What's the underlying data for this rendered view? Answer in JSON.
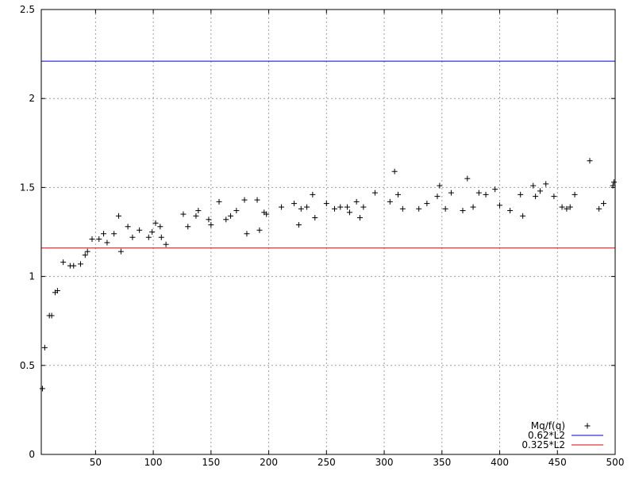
{
  "chart_data": {
    "type": "scatter",
    "title": "",
    "xlabel": "",
    "ylabel": "",
    "xlim": [
      3,
      500
    ],
    "ylim": [
      0,
      2.5
    ],
    "x_ticks": [
      "50",
      "100",
      "150",
      "200",
      "250",
      "300",
      "350",
      "400",
      "450",
      "500"
    ],
    "y_ticks": [
      "0",
      "0.5",
      "1",
      "1.5",
      "2",
      "2.5"
    ],
    "grid": true,
    "legend_position": "bottom-right",
    "series": [
      {
        "name": "Mq/f(q)",
        "kind": "points",
        "marker": "+",
        "color": "#000000",
        "points": [
          [
            4,
            0.37
          ],
          [
            6,
            0.6
          ],
          [
            10,
            0.78
          ],
          [
            12,
            0.78
          ],
          [
            15,
            0.91
          ],
          [
            17,
            0.92
          ],
          [
            22,
            1.08
          ],
          [
            28,
            1.06
          ],
          [
            31,
            1.06
          ],
          [
            37,
            1.07
          ],
          [
            41,
            1.12
          ],
          [
            43,
            1.14
          ],
          [
            47,
            1.21
          ],
          [
            53,
            1.21
          ],
          [
            57,
            1.24
          ],
          [
            60,
            1.19
          ],
          [
            66,
            1.24
          ],
          [
            70,
            1.34
          ],
          [
            72,
            1.14
          ],
          [
            78,
            1.28
          ],
          [
            82,
            1.22
          ],
          [
            88,
            1.26
          ],
          [
            96,
            1.22
          ],
          [
            99,
            1.25
          ],
          [
            102,
            1.3
          ],
          [
            106,
            1.28
          ],
          [
            107,
            1.22
          ],
          [
            111,
            1.18
          ],
          [
            126,
            1.35
          ],
          [
            130,
            1.28
          ],
          [
            137,
            1.34
          ],
          [
            139,
            1.37
          ],
          [
            148,
            1.32
          ],
          [
            150,
            1.29
          ],
          [
            157,
            1.42
          ],
          [
            163,
            1.32
          ],
          [
            167,
            1.34
          ],
          [
            172,
            1.37
          ],
          [
            179,
            1.43
          ],
          [
            181,
            1.24
          ],
          [
            190,
            1.43
          ],
          [
            192,
            1.26
          ],
          [
            196,
            1.36
          ],
          [
            198,
            1.35
          ],
          [
            211,
            1.39
          ],
          [
            222,
            1.41
          ],
          [
            226,
            1.29
          ],
          [
            228,
            1.38
          ],
          [
            233,
            1.39
          ],
          [
            238,
            1.46
          ],
          [
            240,
            1.33
          ],
          [
            250,
            1.41
          ],
          [
            257,
            1.38
          ],
          [
            262,
            1.39
          ],
          [
            268,
            1.39
          ],
          [
            270,
            1.36
          ],
          [
            276,
            1.42
          ],
          [
            279,
            1.33
          ],
          [
            282,
            1.39
          ],
          [
            292,
            1.47
          ],
          [
            305,
            1.42
          ],
          [
            309,
            1.59
          ],
          [
            312,
            1.46
          ],
          [
            316,
            1.38
          ],
          [
            330,
            1.38
          ],
          [
            337,
            1.41
          ],
          [
            346,
            1.45
          ],
          [
            348,
            1.51
          ],
          [
            353,
            1.38
          ],
          [
            358,
            1.47
          ],
          [
            368,
            1.37
          ],
          [
            372,
            1.55
          ],
          [
            377,
            1.39
          ],
          [
            382,
            1.47
          ],
          [
            388,
            1.46
          ],
          [
            396,
            1.49
          ],
          [
            400,
            1.4
          ],
          [
            409,
            1.37
          ],
          [
            418,
            1.46
          ],
          [
            420,
            1.34
          ],
          [
            429,
            1.51
          ],
          [
            431,
            1.45
          ],
          [
            435,
            1.48
          ],
          [
            440,
            1.52
          ],
          [
            447,
            1.45
          ],
          [
            454,
            1.39
          ],
          [
            458,
            1.38
          ],
          [
            461,
            1.39
          ],
          [
            465,
            1.46
          ],
          [
            478,
            1.65
          ],
          [
            486,
            1.38
          ],
          [
            490,
            1.41
          ],
          [
            498,
            1.51
          ],
          [
            499,
            1.53
          ]
        ]
      },
      {
        "name": "0.62*L2",
        "kind": "hline",
        "y": 2.21,
        "color": "#0000cc"
      },
      {
        "name": "0.325*L2",
        "kind": "hline",
        "y": 1.16,
        "color": "#dd0000"
      }
    ]
  }
}
